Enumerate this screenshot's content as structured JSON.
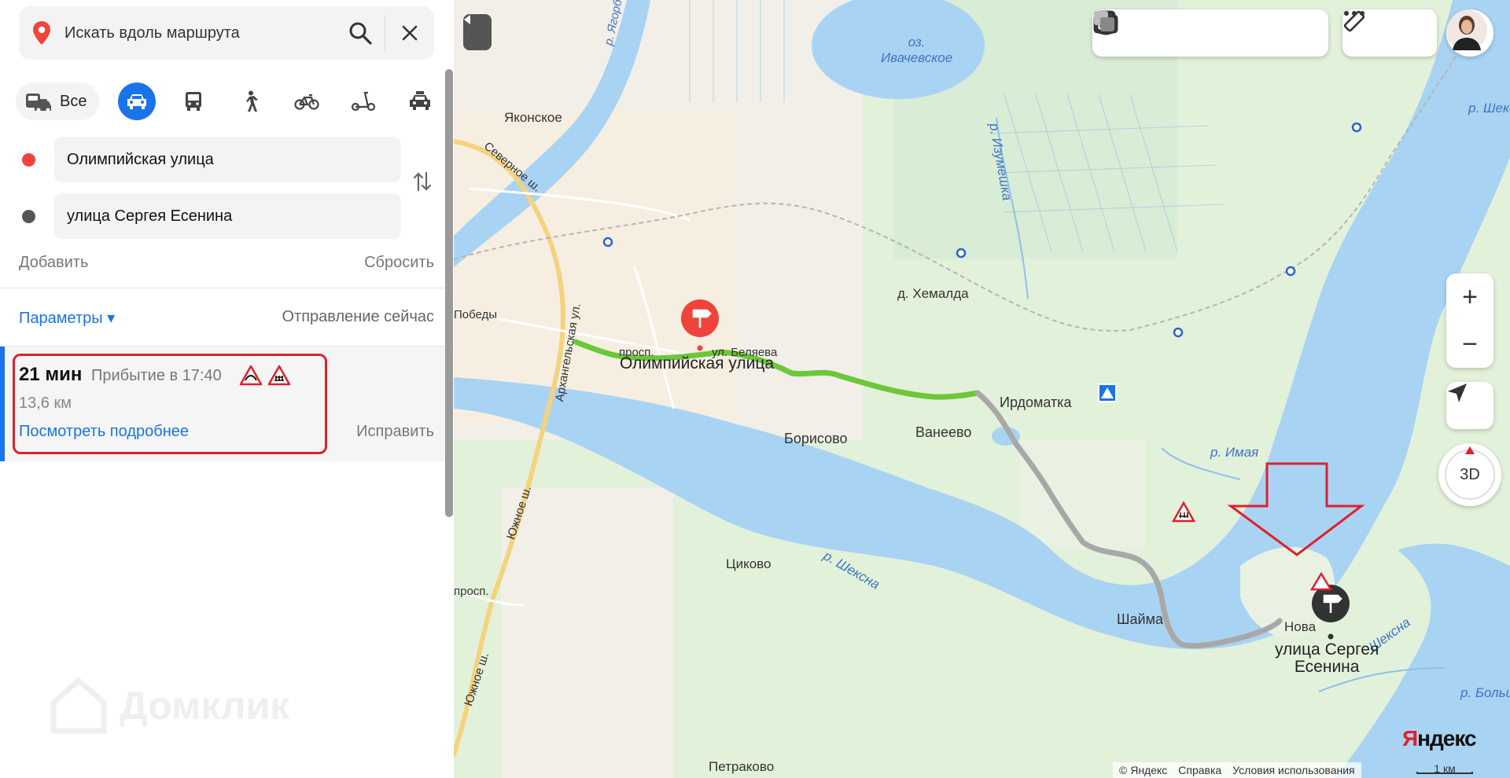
{
  "search": {
    "placeholder": "Искать вдоль маршрута"
  },
  "modes": {
    "all_label": "Все",
    "items": [
      "car-icon",
      "bus-icon",
      "walk-icon",
      "bike-icon",
      "scooter-icon",
      "taxi-icon"
    ],
    "active": "car-icon"
  },
  "waypoints": {
    "from": "Олимпийская улица",
    "to": "улица Сергея Есенина",
    "from_color": "#f0443a",
    "to_color": "#555555"
  },
  "actions": {
    "add": "Добавить",
    "reset": "Сбросить"
  },
  "params": {
    "label": "Параметры ▾",
    "departure": "Отправление сейчас"
  },
  "route": {
    "time": "21 мин",
    "arrival": "Прибытие в 17:40",
    "distance": "13,6 км",
    "details": "Посмотреть подробнее",
    "fix": "Исправить"
  },
  "watermark": "Домклик",
  "map": {
    "labels": {
      "lake": "оз.\nИвачевское",
      "yakonskoe": "Яконское",
      "severnoe": "Северное ш.",
      "pobedy": "Победы",
      "prosp": "просп.",
      "arkh": "Архангельская ул.",
      "belyaeva": "ул. Беляева",
      "olimp": "Олимпийская улица",
      "izumeshka": "р. Изумешка",
      "hemalda": "д. Хемалда",
      "irdomatka": "Ирдоматка",
      "borisovo": "Борисово",
      "vaneevo": "Ванеево",
      "imaya": "р. Имая",
      "tsikovo": "Циково",
      "sheksna1": "р. Шексна",
      "sheksna2": "р. Шекс",
      "sheksna3": "Шексна",
      "shaima": "Шайма",
      "nova": "Нова",
      "esenina": "улица Сергея\nЕсенина",
      "yuzhnoe1": "Южное ш.",
      "yuzhnoe2": "Южное ш.",
      "prosp2": "просп.",
      "petrakovo": "Петраково",
      "bolshoy": "р. Большо",
      "yarog": "р. Ягорба"
    },
    "footer": [
      "© Яндекс",
      "Справка",
      "Условия использования"
    ],
    "scale": "1 км",
    "logo": "Яндекс",
    "btn3d": "3D",
    "route_colors": {
      "fast": "#6cc73a",
      "slow": "#a8a8a8",
      "marker": "#f0443a",
      "end_marker": "#333333"
    }
  }
}
